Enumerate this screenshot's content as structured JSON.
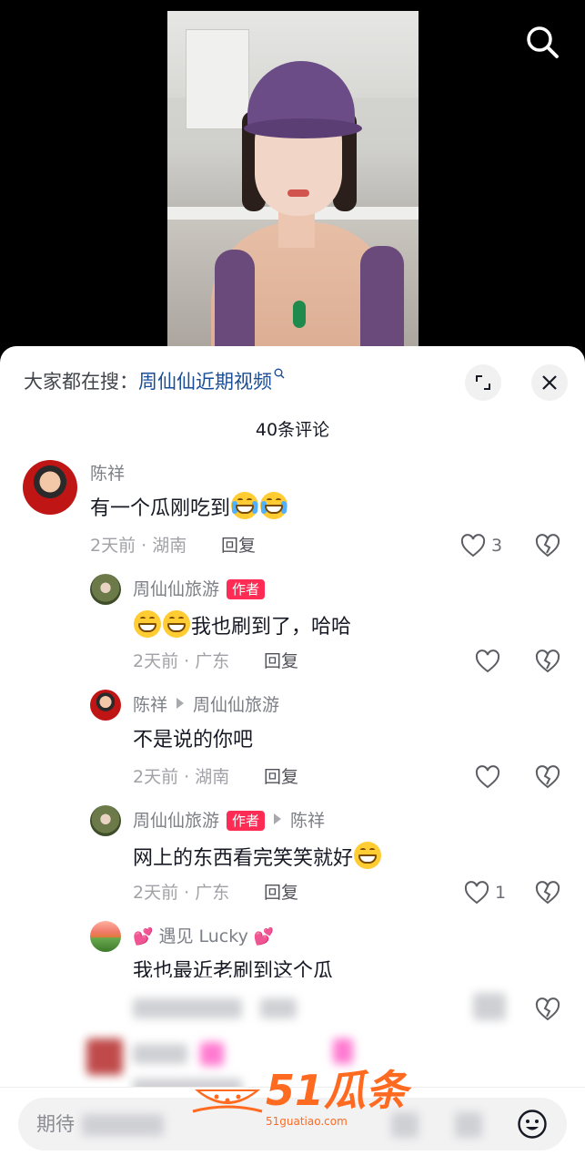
{
  "video": {
    "description_icon": "search-icon"
  },
  "sheet": {
    "search_prefix": "大家都在搜：",
    "search_term": "周仙仙近期视频",
    "comment_count": "40条评论"
  },
  "comments": [
    {
      "nickname": "陈祥",
      "content": "有一个瓜刚吃到",
      "time_location": "2天前 · 湖南",
      "reply": "回复",
      "likes": "3"
    },
    {
      "nickname": "周仙仙旅游",
      "author_tag": "作者",
      "content": "我也刷到了，哈哈",
      "time_location": "2天前 · 广东",
      "reply": "回复",
      "likes": ""
    },
    {
      "nickname": "陈祥",
      "reply_to": "周仙仙旅游",
      "content": "不是说的你吧",
      "time_location": "2天前 · 湖南",
      "reply": "回复",
      "likes": ""
    },
    {
      "nickname": "周仙仙旅游",
      "author_tag": "作者",
      "reply_to": "陈祥",
      "content": "网上的东西看完笑笑就好",
      "time_location": "2天前 · 广东",
      "reply": "回复",
      "likes": "1"
    },
    {
      "nickname": "遇见 Lucky",
      "content": "我也最近老刷到这个瓜"
    }
  ],
  "input": {
    "placeholder": "期待"
  },
  "watermark": {
    "brand": "51瓜条",
    "url": "51guatiao.com"
  },
  "colors": {
    "accent": "#fe2c55",
    "link": "#1a4e97",
    "watermark": "#ff6a21"
  }
}
